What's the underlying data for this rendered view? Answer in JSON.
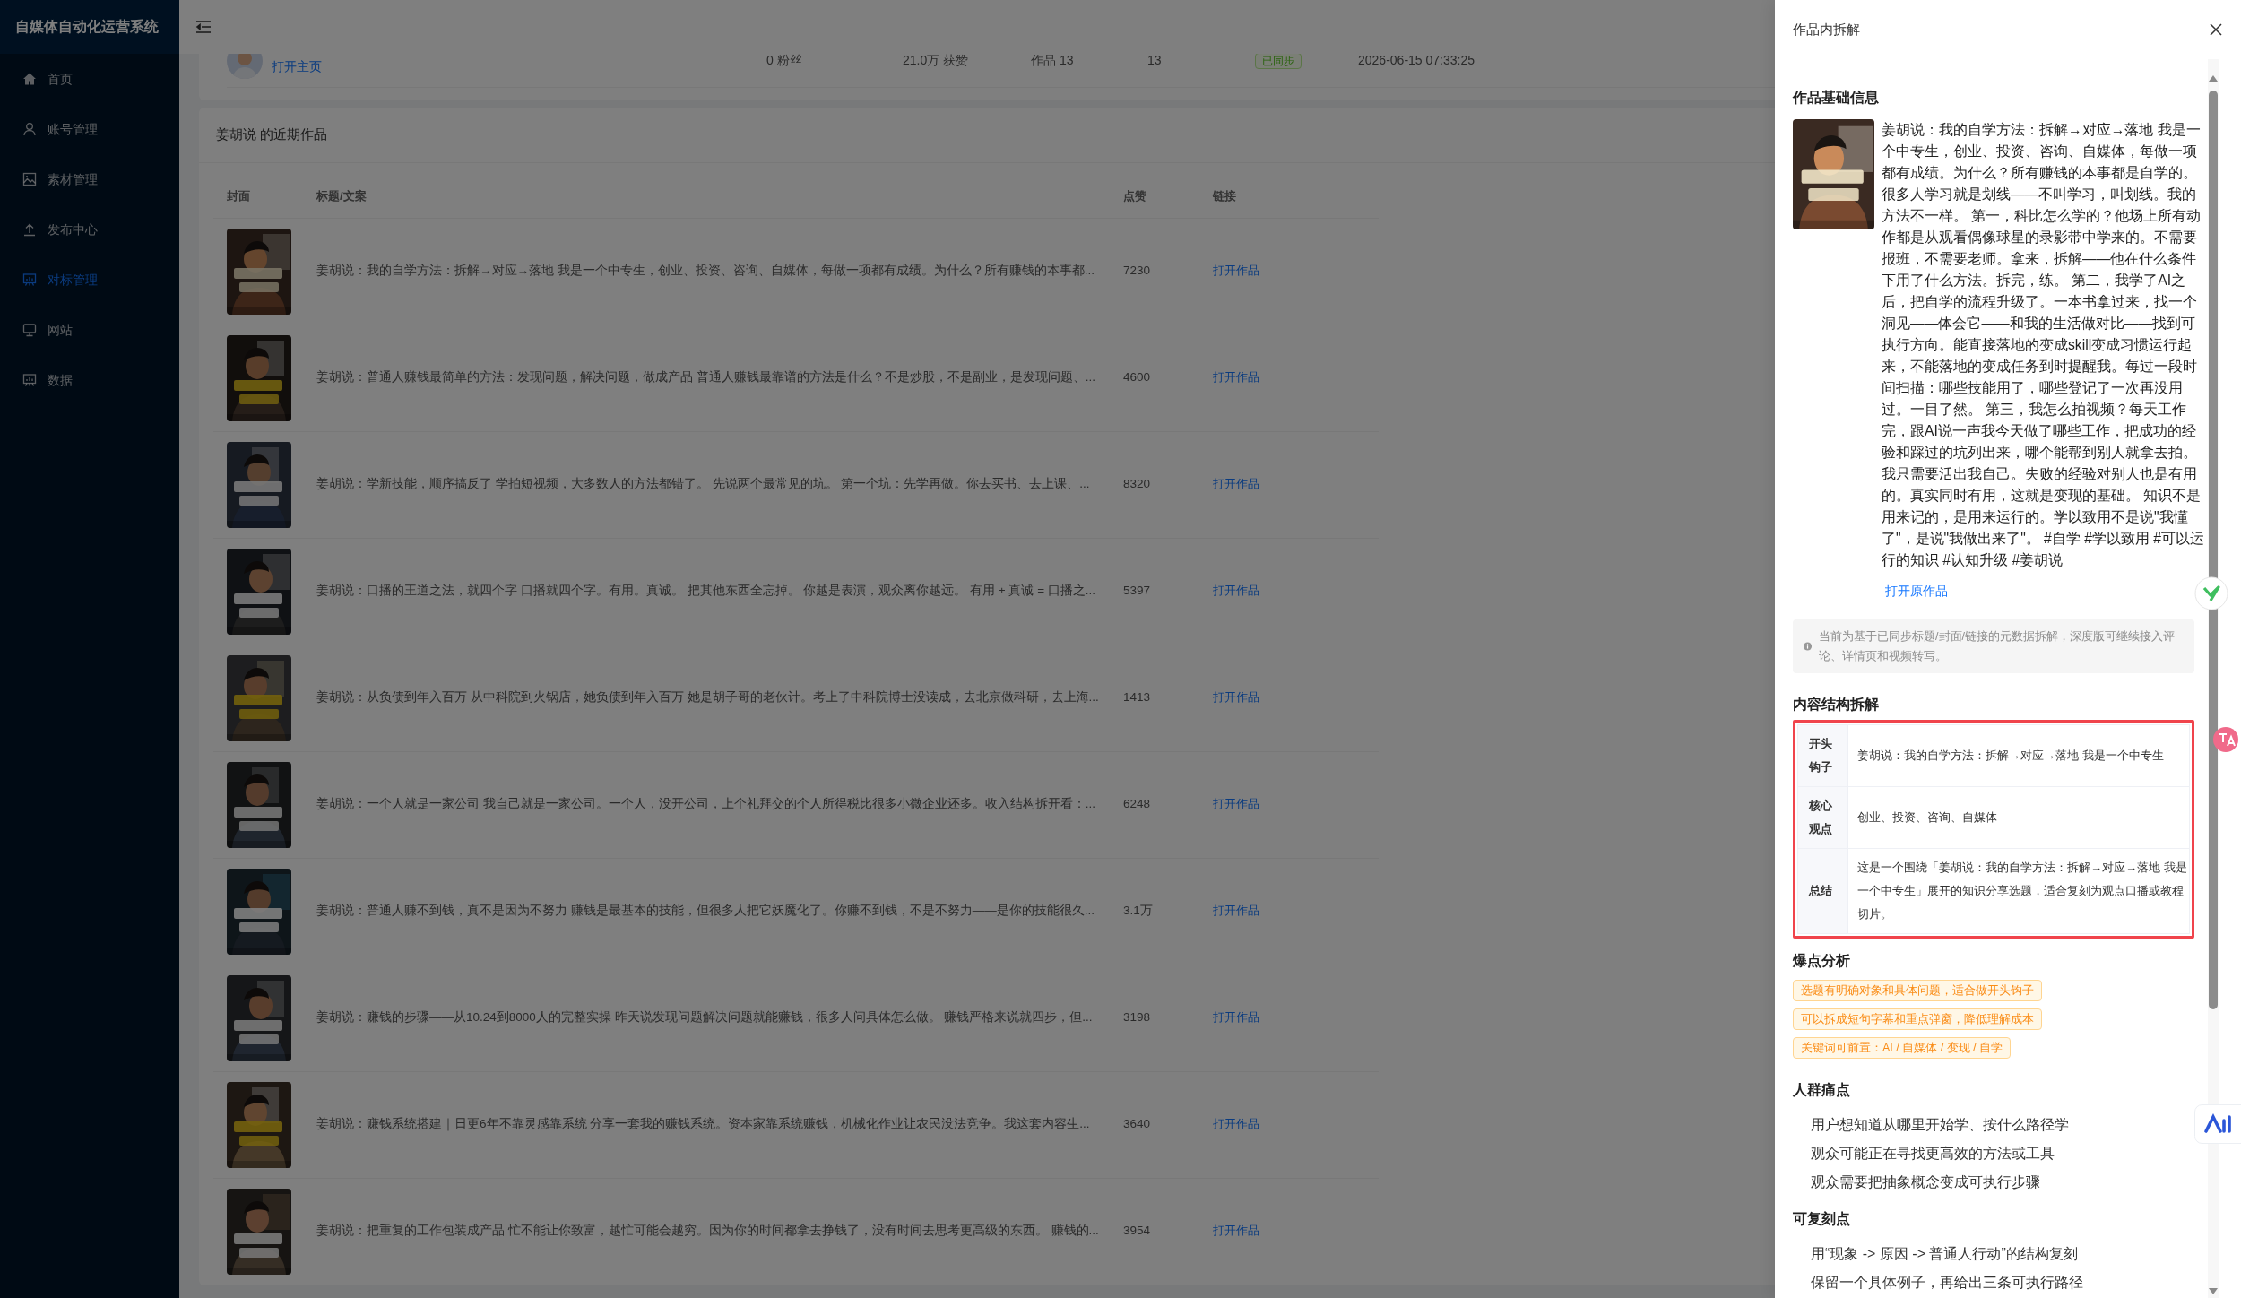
{
  "sidebar": {
    "title": "自媒体自动化运营系统",
    "items": [
      {
        "label": "首页",
        "selected": false
      },
      {
        "label": "账号管理",
        "selected": false
      },
      {
        "label": "素材管理",
        "selected": false
      },
      {
        "label": "发布中心",
        "selected": false
      },
      {
        "label": "对标管理",
        "selected": true
      },
      {
        "label": "网站",
        "selected": false
      },
      {
        "label": "数据",
        "selected": false
      }
    ]
  },
  "account": {
    "link": "打开主页",
    "fans": "0 粉丝",
    "likes": "21.0万 获赞",
    "works": "作品 13",
    "count": "13",
    "status": "已同步",
    "synced_at": "2026-06-15 07:33:25"
  },
  "works": {
    "title": "姜胡说 的近期作品",
    "columns": [
      "封面",
      "标题/文案",
      "点赞",
      "链接"
    ],
    "rows": [
      {
        "title": "姜胡说：我的自学方法：拆解→对应→落地 我是一个中专生，创业、投资、咨询、自媒体，每做一项都有成绩。为什么？所有赚钱的本事都...",
        "likes": "7230",
        "link": "打开作品"
      },
      {
        "title": "姜胡说：普通人赚钱最简单的方法：发现问题，解决问题，做成产品 普通人赚钱最靠谱的方法是什么？不是炒股，不是副业，是发现问题、...",
        "likes": "4600",
        "link": "打开作品"
      },
      {
        "title": "姜胡说：学新技能，顺序搞反了 学拍短视频，大多数人的方法都错了。 先说两个最常见的坑。 第一个坑：先学再做。你去买书、去上课、...",
        "likes": "8320",
        "link": "打开作品"
      },
      {
        "title": "姜胡说：口播的王道之法，就四个字 口播就四个字。有用。真诚。 把其他东西全忘掉。 你越是表演，观众离你越远。 有用 + 真诚 = 口播之...",
        "likes": "5397",
        "link": "打开作品"
      },
      {
        "title": "姜胡说：从负债到年入百万 从中科院到火锅店，她负债到年入百万 她是胡子哥的老伙计。考上了中科院博士没读成，去北京做科研，去上海...",
        "likes": "1413",
        "link": "打开作品"
      },
      {
        "title": "姜胡说：一个人就是一家公司 我自己就是一家公司。一个人，没开公司，上个礼拜交的个人所得税比很多小微企业还多。收入结构拆开看：...",
        "likes": "6248",
        "link": "打开作品"
      },
      {
        "title": "姜胡说：普通人赚不到钱，真不是因为不努力 赚钱是最基本的技能，但很多人把它妖魔化了。你赚不到钱，不是不努力——是你的技能很久...",
        "likes": "3.1万",
        "link": "打开作品"
      },
      {
        "title": "姜胡说：赚钱的步骤——从10.24到8000人的完整实操 昨天说发现问题解决问题就能赚钱，很多人问具体怎么做。 赚钱严格来说就四步，但...",
        "likes": "3198",
        "link": "打开作品"
      },
      {
        "title": "姜胡说：赚钱系统搭建｜日更6年不靠灵感靠系统 分享一套我的赚钱系统。资本家靠系统赚钱，机械化作业让农民没法竞争。我这套内容生...",
        "likes": "3640",
        "link": "打开作品"
      },
      {
        "title": "姜胡说：把重复的工作包装成产品 忙不能让你致富，越忙可能会越穷。因为你的时间都拿去挣钱了，没有时间去思考更高级的东西。 赚钱的...",
        "likes": "3954",
        "link": "打开作品"
      }
    ]
  },
  "drawer": {
    "title": "作品内拆解",
    "basic_info": {
      "heading": "作品基础信息",
      "description": "姜胡说：我的自学方法：拆解→对应→落地 我是一个中专生，创业、投资、咨询、自媒体，每做一项都有成绩。为什么？所有赚钱的本事都是自学的。很多人学习就是划线——不叫学习，叫划线。我的方法不一样。 第一，科比怎么学的？他场上所有动作都是从观看偶像球星的录影带中学来的。不需要报班，不需要老师。拿来，拆解——他在什么条件下用了什么方法。拆完，练。 第二，我学了AI之后，把自学的流程升级了。一本书拿过来，找一个洞见——体会它——和我的生活做对比——找到可执行方向。能直接落地的变成skill变成习惯运行起来，不能落地的变成任务到时提醒我。每过一段时间扫描：哪些技能用了，哪些登记了一次再没用过。一目了然。 第三，我怎么拍视频？每天工作完，跟AI说一声我今天做了哪些工作，把成功的经验和踩过的坑列出来，哪个能帮到别人就拿去拍。我只需要活出我自己。失败的经验对别人也是有用的。真实同时有用，这就是变现的基础。 知识不是用来记的，是用来运行的。学以致用不是说\"我懂了\"，是说\"我做出来了\"。 #自学 #学以致用 #可以运行的知识 #认知升级 #姜胡说",
      "link": "打开原作品",
      "note": "当前为基于已同步标题/封面/链接的元数据拆解，深度版可继续接入评论、详情页和视频转写。"
    },
    "structure": {
      "heading": "内容结构拆解",
      "rows": [
        {
          "label": "开头钩子",
          "text": "姜胡说：我的自学方法：拆解→对应→落地 我是一个中专生"
        },
        {
          "label": "核心观点",
          "text": "创业、投资、咨询、自媒体"
        },
        {
          "label": "总结",
          "text": "这是一个围绕「姜胡说：我的自学方法：拆解→对应→落地 我是一个中专生」展开的知识分享选题，适合复刻为观点口播或教程切片。"
        }
      ]
    },
    "highlights": {
      "heading": "爆点分析",
      "tags": [
        "选题有明确对象和具体问题，适合做开头钩子",
        "可以拆成短句字幕和重点弹窗，降低理解成本",
        "关键词可前置：AI / 自媒体 / 变现 / 自学"
      ]
    },
    "pain_points": {
      "heading": "人群痛点",
      "items": [
        "用户想知道从哪里开始学、按什么路径学",
        "观众可能正在寻找更高效的方法或工具",
        "观众需要把抽象概念变成可执行步骤"
      ]
    },
    "replicable": {
      "heading": "可复刻点",
      "items": [
        "用“现象 -> 原因 -> 普通人行动”的结构复刻",
        "保留一个具体例子，再给出三条可执行路径"
      ]
    }
  }
}
